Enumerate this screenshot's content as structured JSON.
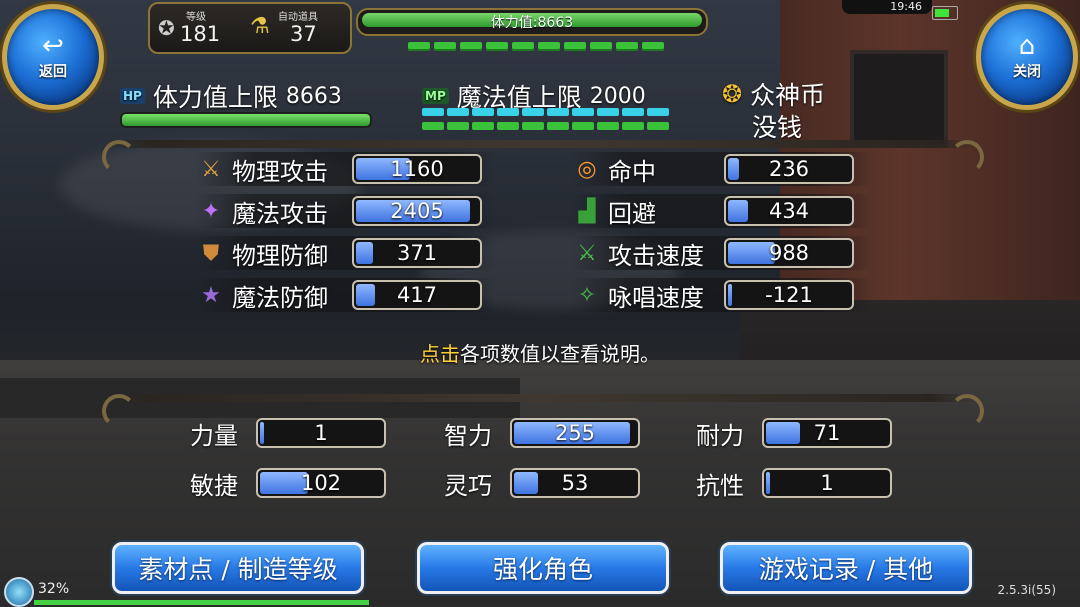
{
  "top": {
    "back_label": "返回",
    "close_label": "关闭",
    "level_caption": "等级",
    "level_value": "181",
    "auto_caption": "自动道具",
    "auto_value": "37",
    "hp_bar_text": "体力值:8663",
    "clock": "19:46"
  },
  "header": {
    "hp_badge": "HP",
    "hp_label": "体力值上限",
    "hp_value": "8663",
    "mp_badge": "MP",
    "mp_label": "魔法值上限",
    "mp_value": "2000",
    "coin_label": "众神币",
    "coin_value": "没钱"
  },
  "combat_stats": [
    {
      "label": "物理攻击",
      "value": "1160",
      "fill": 0.45,
      "icon": "sword-icon",
      "glyph": "⚔",
      "color": "#e0a33a"
    },
    {
      "label": "魔法攻击",
      "value": "2405",
      "fill": 0.95,
      "icon": "staff-icon",
      "glyph": "✦",
      "color": "#c070ff"
    },
    {
      "label": "物理防御",
      "value": "371",
      "fill": 0.14,
      "icon": "shield-icon",
      "glyph": "⛊",
      "color": "#d08a3a"
    },
    {
      "label": "魔法防御",
      "value": "417",
      "fill": 0.16,
      "icon": "magic-shield-icon",
      "glyph": "★",
      "color": "#9a6ad8"
    },
    {
      "label": "命中",
      "value": "236",
      "fill": 0.09,
      "icon": "target-icon",
      "glyph": "◎",
      "color": "#ff9a2a"
    },
    {
      "label": "回避",
      "value": "434",
      "fill": 0.17,
      "icon": "boot-icon",
      "glyph": "▟",
      "color": "#3aa03a"
    },
    {
      "label": "攻击速度",
      "value": "988",
      "fill": 0.39,
      "icon": "attack-speed-icon",
      "glyph": "⚔",
      "color": "#4ac04a"
    },
    {
      "label": "咏唱速度",
      "value": "-121",
      "fill": 0.0,
      "icon": "cast-speed-icon",
      "glyph": "✧",
      "color": "#4ac04a"
    }
  ],
  "hint": {
    "highlight": "点击",
    "rest": "各项数值以查看说明。"
  },
  "base_stats": [
    {
      "label": "力量",
      "value": "1",
      "fill": 0.0
    },
    {
      "label": "智力",
      "value": "255",
      "fill": 0.97
    },
    {
      "label": "耐力",
      "value": "71",
      "fill": 0.28
    },
    {
      "label": "敏捷",
      "value": "102",
      "fill": 0.4
    },
    {
      "label": "灵巧",
      "value": "53",
      "fill": 0.2
    },
    {
      "label": "抗性",
      "value": "1",
      "fill": 0.0
    }
  ],
  "buttons": {
    "materials": "素材点 / 制造等级",
    "enhance": "强化角色",
    "records": "游戏记录 / 其他"
  },
  "footer": {
    "exp_percent": "32%",
    "exp_fill": 0.32,
    "version": "2.5.3i(55)"
  }
}
